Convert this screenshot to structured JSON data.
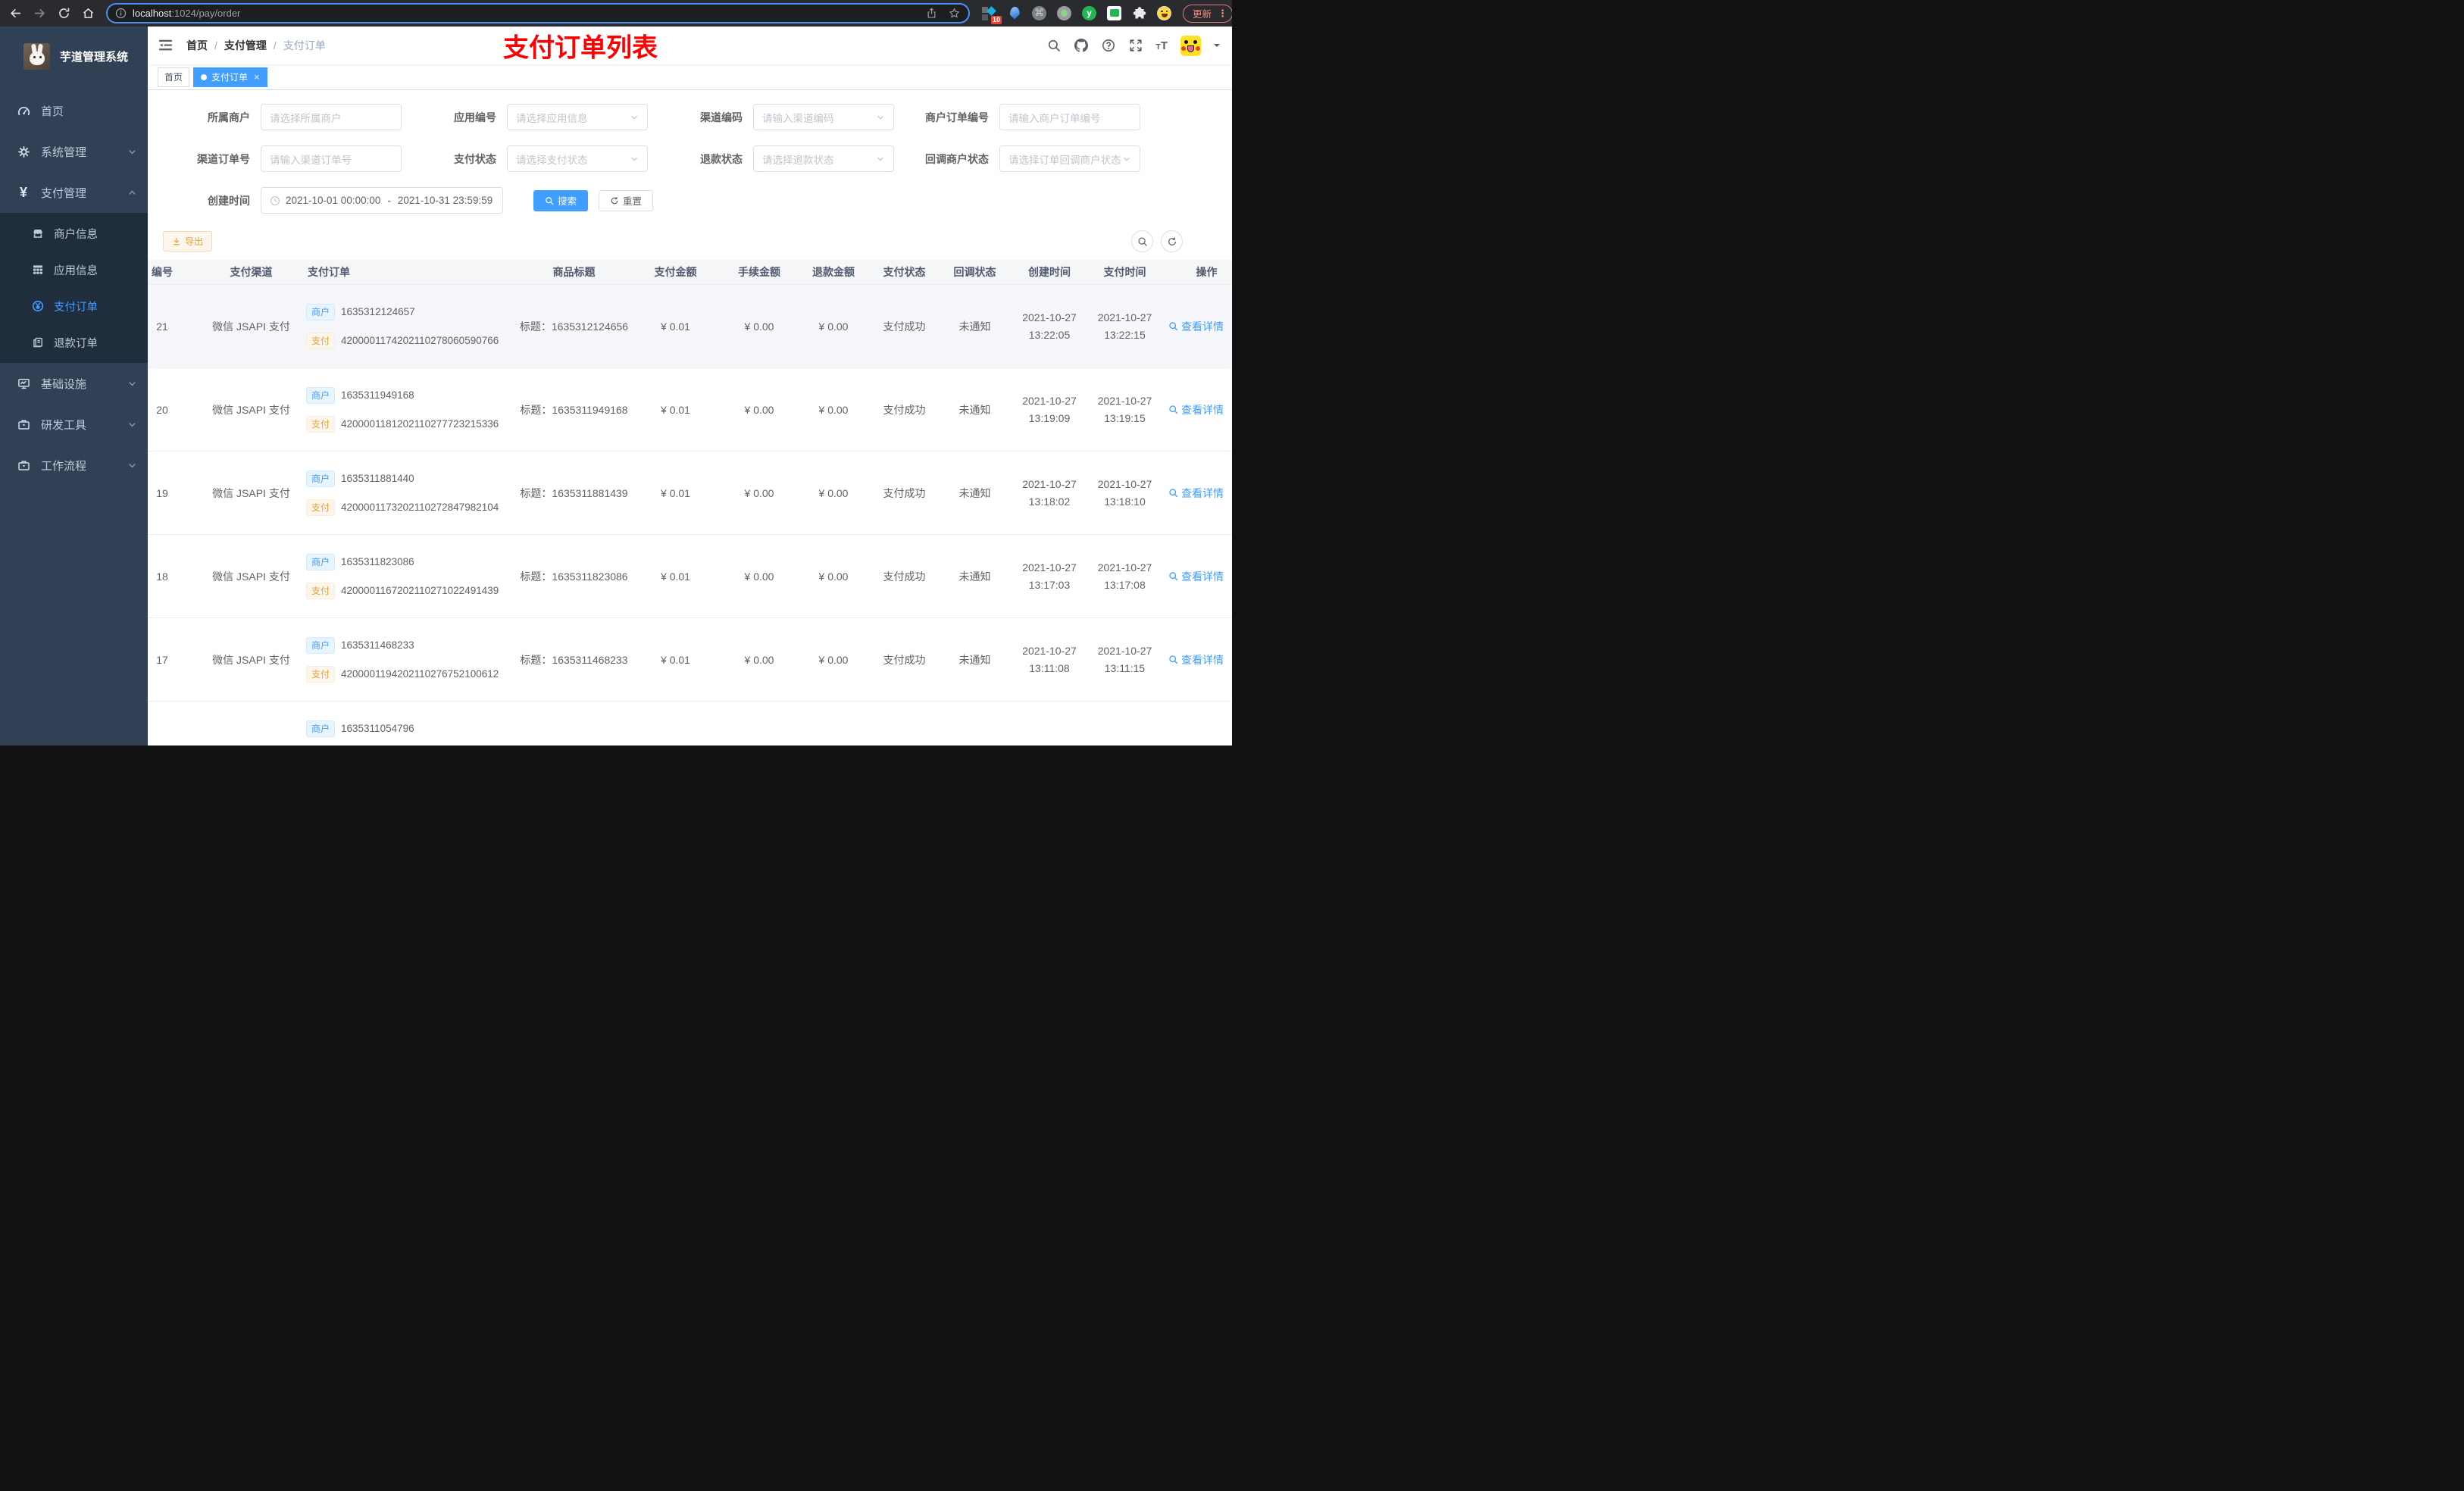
{
  "colors": {
    "accent": "#409eff",
    "warning": "#e6a23c",
    "watermark_red": "#ff0000",
    "sidebar_bg": "#304156",
    "submenu_bg": "#1f2d3d"
  },
  "browser": {
    "url_host": "localhost",
    "url_path": ":1024/pay/order",
    "extension_badge": "10",
    "cmd_glyph": "⌘",
    "y_glyph": "y",
    "update_label": "更新",
    "menu_dots": "⋮"
  },
  "sidebar": {
    "app_title": "芋道管理系统",
    "items": [
      {
        "label": "首页"
      },
      {
        "label": "系统管理"
      },
      {
        "label": "支付管理"
      },
      {
        "label": "商户信息"
      },
      {
        "label": "应用信息"
      },
      {
        "label": "支付订单"
      },
      {
        "label": "退款订单"
      },
      {
        "label": "基础设施"
      },
      {
        "label": "研发工具"
      },
      {
        "label": "工作流程"
      }
    ]
  },
  "navbar": {
    "breadcrumb": [
      "首页",
      "支付管理",
      "支付订单"
    ],
    "separator": "/",
    "watermark_title": "支付订单列表"
  },
  "tabs": {
    "home": "首页",
    "active": "支付订单",
    "close_glyph": "×"
  },
  "filters": {
    "merchant": {
      "label": "所属商户",
      "placeholder": "请选择所属商户"
    },
    "app_no": {
      "label": "应用编号",
      "placeholder": "请选择应用信息"
    },
    "channel_code": {
      "label": "渠道编码",
      "placeholder": "请输入渠道编码"
    },
    "merchant_order_no": {
      "label": "商户订单编号",
      "placeholder": "请输入商户订单编号"
    },
    "channel_order_no": {
      "label": "渠道订单号",
      "placeholder": "请输入渠道订单号"
    },
    "pay_status": {
      "label": "支付状态",
      "placeholder": "请选择支付状态"
    },
    "refund_status": {
      "label": "退款状态",
      "placeholder": "请选择退款状态"
    },
    "notify_status": {
      "label": "回调商户状态",
      "placeholder": "请选择订单回调商户状态"
    },
    "create_time": {
      "label": "创建时间",
      "start": "2021-10-01 00:00:00",
      "separator": "-",
      "end": "2021-10-31 23:59:59"
    },
    "search_label": "搜索",
    "reset_label": "重置"
  },
  "toolbar": {
    "export_label": "导出"
  },
  "table": {
    "columns": [
      "编号",
      "支付渠道",
      "支付订单",
      "商品标题",
      "支付金额",
      "手续金额",
      "退款金额",
      "支付状态",
      "回调状态",
      "创建时间",
      "支付时间",
      "操作"
    ],
    "tag_merchant": "商户",
    "tag_pay": "支付",
    "rows": [
      {
        "id": "21",
        "channel": "微信 JSAPI 支付",
        "merchant_no": "1635312124657",
        "pay_no": "4200001174202110278060590766",
        "title": "标题：1635312124656",
        "amount": "¥ 0.01",
        "fee": "¥ 0.00",
        "refund": "¥ 0.00",
        "status": "支付成功",
        "notify": "未通知",
        "create_date": "2021-10-27",
        "create_time": "13:22:05",
        "pay_date": "2021-10-27",
        "pay_time": "13:22:15",
        "action": "查看详情"
      },
      {
        "id": "20",
        "channel": "微信 JSAPI 支付",
        "merchant_no": "1635311949168",
        "pay_no": "4200001181202110277723215336",
        "title": "标题：1635311949168",
        "amount": "¥ 0.01",
        "fee": "¥ 0.00",
        "refund": "¥ 0.00",
        "status": "支付成功",
        "notify": "未通知",
        "create_date": "2021-10-27",
        "create_time": "13:19:09",
        "pay_date": "2021-10-27",
        "pay_time": "13:19:15",
        "action": "查看详情"
      },
      {
        "id": "19",
        "channel": "微信 JSAPI 支付",
        "merchant_no": "1635311881440",
        "pay_no": "4200001173202110272847982104",
        "title": "标题：1635311881439",
        "amount": "¥ 0.01",
        "fee": "¥ 0.00",
        "refund": "¥ 0.00",
        "status": "支付成功",
        "notify": "未通知",
        "create_date": "2021-10-27",
        "create_time": "13:18:02",
        "pay_date": "2021-10-27",
        "pay_time": "13:18:10",
        "action": "查看详情"
      },
      {
        "id": "18",
        "channel": "微信 JSAPI 支付",
        "merchant_no": "1635311823086",
        "pay_no": "4200001167202110271022491439",
        "title": "标题：1635311823086",
        "amount": "¥ 0.01",
        "fee": "¥ 0.00",
        "refund": "¥ 0.00",
        "status": "支付成功",
        "notify": "未通知",
        "create_date": "2021-10-27",
        "create_time": "13:17:03",
        "pay_date": "2021-10-27",
        "pay_time": "13:17:08",
        "action": "查看详情"
      },
      {
        "id": "17",
        "channel": "微信 JSAPI 支付",
        "merchant_no": "1635311468233",
        "pay_no": "4200001194202110276752100612",
        "title": "标题：1635311468233",
        "amount": "¥ 0.01",
        "fee": "¥ 0.00",
        "refund": "¥ 0.00",
        "status": "支付成功",
        "notify": "未通知",
        "create_date": "2021-10-27",
        "create_time": "13:11:08",
        "pay_date": "2021-10-27",
        "pay_time": "13:11:15",
        "action": "查看详情"
      }
    ],
    "partial_row": {
      "merchant_no": "1635311054796"
    }
  }
}
